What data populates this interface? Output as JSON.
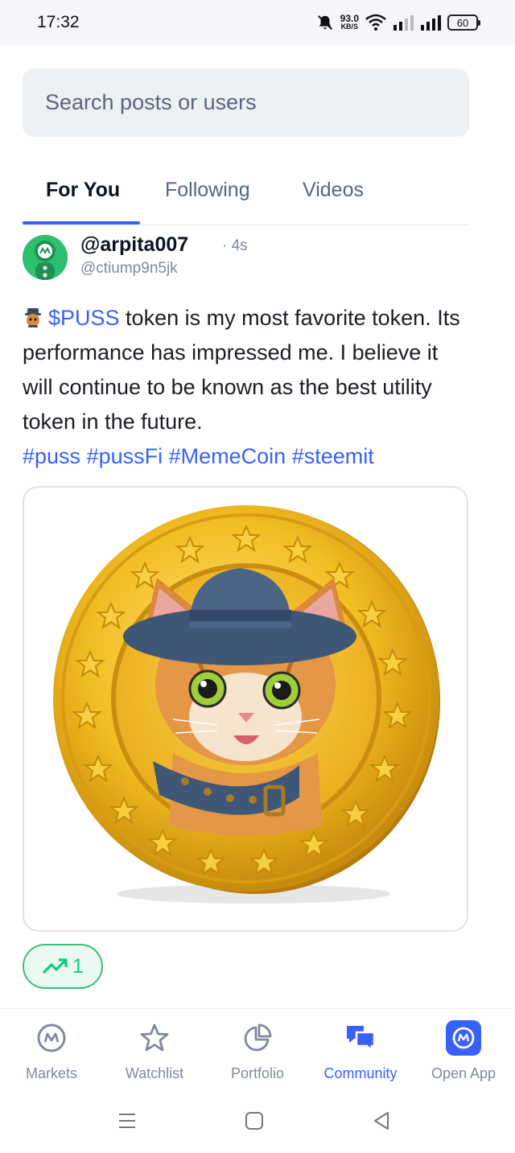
{
  "status_bar": {
    "time": "17:32",
    "net_speed_value": "93.0",
    "net_speed_unit": "KB/S",
    "battery": "60",
    "icons": [
      "mute-icon",
      "wifi-icon",
      "signal-icon",
      "signal-icon",
      "battery-icon"
    ]
  },
  "search": {
    "placeholder": "Search posts or users"
  },
  "tabs": [
    {
      "label": "For You",
      "active": true
    },
    {
      "label": "Following",
      "active": false
    },
    {
      "label": "Videos",
      "active": false
    }
  ],
  "post": {
    "username": "@arpita007",
    "time": "· 4s",
    "handle": "@ctiump9n5jk",
    "cashtag": "$PUSS",
    "text": " token is my most favorite token. Its performance has impressed me. I believe it will continue to be known as the best utility token in the future.",
    "hashtags": [
      "#puss",
      "#pussFi",
      "#MemeCoin",
      "#steemit"
    ],
    "image": "gold-coin-cat-image",
    "reaction": {
      "icon": "trending-up-icon",
      "count": "1"
    }
  },
  "bottom_nav": [
    {
      "label": "Markets",
      "icon": "markets-icon",
      "active": false
    },
    {
      "label": "Watchlist",
      "icon": "star-icon",
      "active": false
    },
    {
      "label": "Portfolio",
      "icon": "pie-chart-icon",
      "active": false
    },
    {
      "label": "Community",
      "icon": "chat-bubbles-icon",
      "active": true
    },
    {
      "label": "Open App",
      "icon": "app-logo-icon",
      "active": false
    }
  ],
  "colors": {
    "accent": "#3861fb",
    "positive": "#16c784",
    "muted": "#808a9d"
  }
}
